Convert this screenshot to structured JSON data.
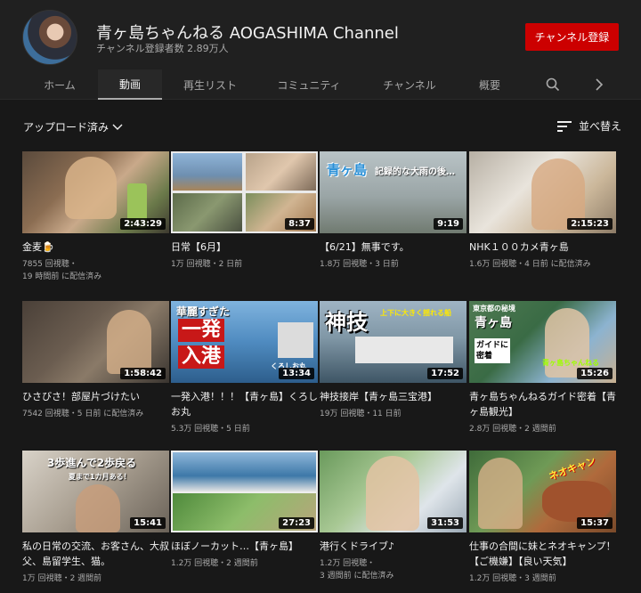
{
  "channel": {
    "name": "青ヶ島ちゃんねる AOGASHIMA Channel",
    "subscribers": "チャンネル登録者数 2.89万人",
    "subscribe_label": "チャンネル登録"
  },
  "tabs": [
    {
      "label": "ホーム"
    },
    {
      "label": "動画"
    },
    {
      "label": "再生リスト"
    },
    {
      "label": "コミュニティ"
    },
    {
      "label": "チャンネル"
    },
    {
      "label": "概要"
    }
  ],
  "icons": {
    "search": "search-icon",
    "next": "chevron-right-icon",
    "sort": "sort-icon",
    "dropdown": "chevron-down-icon"
  },
  "filter": {
    "label": "アップロード済み"
  },
  "sort": {
    "label": "並べ替え"
  },
  "videos": [
    {
      "title": "金麦🍺",
      "views": "7855 回視聴・",
      "time": "19 時間前 に配信済み",
      "duration": "2:43:29"
    },
    {
      "title": "日常【6月】",
      "views": "1万 回視聴・2 日前",
      "time": "",
      "duration": "8:37"
    },
    {
      "title": "【6/21】無事です。",
      "views": "1.8万 回視聴・3 日前",
      "time": "",
      "duration": "9:19",
      "overlay": "青ヶ島",
      "overlay2": "記録的な大雨の後…"
    },
    {
      "title": "NHK１００カメ青ヶ島",
      "views": "1.6万 回視聴・4 日前 に配信済み",
      "time": "",
      "duration": "2:15:23"
    },
    {
      "title": "ひさびさ！部屋片づけたい",
      "views": "7542 回視聴・5 日前 に配信済み",
      "time": "",
      "duration": "1:58:42"
    },
    {
      "title": "一発入港！！！【青ヶ島】くろしお丸",
      "views": "5.3万 回視聴・5 日前",
      "time": "",
      "duration": "13:34",
      "overlay": "華麗すぎた",
      "overlay2": "一発",
      "overlay3": "入港",
      "overlay4": "くろしお丸"
    },
    {
      "title": "神技接岸【青ヶ島三宝港】",
      "views": "19万 回視聴・11 日前",
      "time": "",
      "duration": "17:52",
      "overlay": "神技",
      "overlay2": "上下に大きく揺れる船"
    },
    {
      "title": "青ヶ島ちゃんねるガイド密着【青ヶ島観光】",
      "views": "2.8万 回視聴・2 週間前",
      "time": "",
      "duration": "15:26",
      "overlay": "東京都の秘境",
      "overlay2": "青ヶ島",
      "overlay3": "ガイドに密着",
      "overlay4": "青ヶ島ちゃんねる"
    },
    {
      "title": "私の日常の交流、お客さん、大叔父、島留学生、猫。",
      "views": "1万 回視聴・2 週間前",
      "time": "",
      "duration": "15:41",
      "overlay": "3歩進んで2歩戻る",
      "overlay2": "夏まで1カ月ある！"
    },
    {
      "title": "ほぼノーカット…【青ヶ島】",
      "views": "1.2万 回視聴・2 週間前",
      "time": "",
      "duration": "27:23"
    },
    {
      "title": "港行くドライブ♪",
      "views": "1.2万 回視聴・",
      "time": "3 週間前 に配信済み",
      "duration": "31:53"
    },
    {
      "title": "仕事の合間に妹とネオキャンプ！【ご機嫌】【良い天気】",
      "views": "1.2万 回視聴・3 週間前",
      "time": "",
      "duration": "15:37",
      "overlay": "ネオキャン"
    }
  ]
}
